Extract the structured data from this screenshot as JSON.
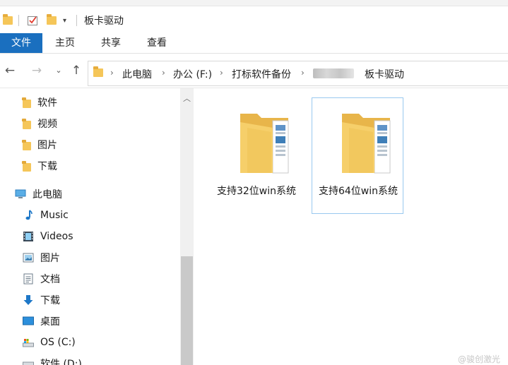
{
  "window": {
    "title": "板卡驱动"
  },
  "ribbon": {
    "tabs": [
      "文件",
      "主页",
      "共享",
      "查看"
    ]
  },
  "address": {
    "crumbs": [
      "此电脑",
      "办公 (F:)",
      "打标软件备份"
    ],
    "current": "板卡驱动"
  },
  "sidebar": {
    "quick": [
      "软件",
      "视频",
      "图片",
      "下载"
    ],
    "thispc": "此电脑",
    "pc_items": [
      "Music",
      "Videos",
      "图片",
      "文档",
      "下载",
      "桌面",
      "OS (C:)",
      "软件 (D:)"
    ]
  },
  "files": [
    {
      "name": "支持32位win系统"
    },
    {
      "name": "支持64位win系统"
    }
  ],
  "watermark": "@骏创激光",
  "colors": {
    "accent": "#1a6fbf",
    "folder": "#f5c659",
    "selection": "#99c9ef"
  }
}
